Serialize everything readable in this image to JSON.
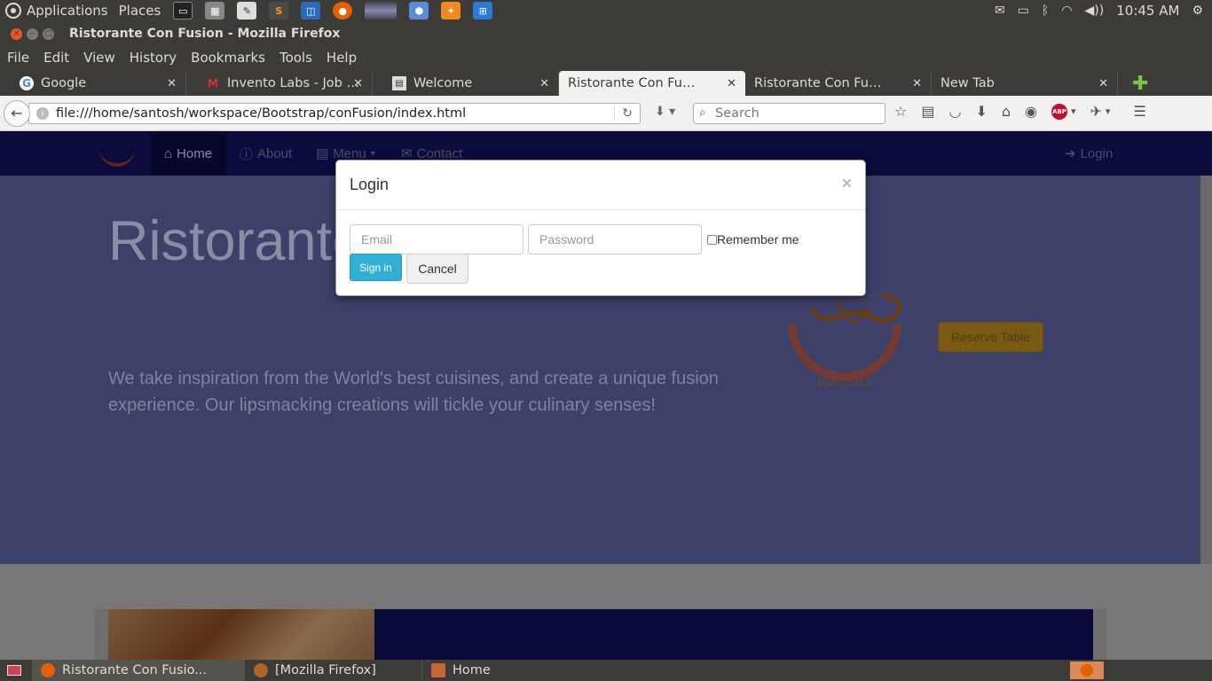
{
  "top_panel": {
    "applications": "Applications",
    "places": "Places",
    "clock": "10:45 AM"
  },
  "window": {
    "title": "Ristorante Con Fusion - Mozilla Firefox"
  },
  "menubar": [
    "File",
    "Edit",
    "View",
    "History",
    "Bookmarks",
    "Tools",
    "Help"
  ],
  "tabs": [
    {
      "label": "Google",
      "icon": "google-icon"
    },
    {
      "label": "Invento Labs - Job O...",
      "icon": "gmail-icon"
    },
    {
      "label": "Welcome",
      "icon": "page-icon"
    },
    {
      "label": "Ristorante Con Fusion",
      "icon": ""
    },
    {
      "label": "Ristorante Con Fusion: ...",
      "icon": ""
    },
    {
      "label": "New Tab",
      "icon": ""
    }
  ],
  "navbar": {
    "url": "file:///home/santosh/workspace/Bootstrap/conFusion/index.html",
    "search_placeholder": "Search"
  },
  "site": {
    "nav": {
      "home": "Home",
      "about": "About",
      "menu": "Menu",
      "contact": "Contact",
      "login": "Login"
    },
    "title": "Ristorante con Fusion",
    "description": "We take inspiration from the World's best cuisines, and create a unique fusion experience. Our lipsmacking creations will tickle your culinary senses!",
    "logo_text": "Ristorante con Fusion",
    "logo_est": "Est. 2013",
    "reserve_button": "Reserve Table"
  },
  "modal": {
    "title": "Login",
    "close": "×",
    "email_placeholder": "Email",
    "password_placeholder": "Password",
    "remember": "Remember me",
    "signin": "Sign in",
    "cancel": "Cancel"
  },
  "taskbar": [
    {
      "label": "Ristorante Con Fusio..."
    },
    {
      "label": "[Mozilla Firefox]"
    },
    {
      "label": "Home"
    }
  ],
  "colors": {
    "panel": "#3c3b37",
    "site_nav": "#0b0c3d",
    "jumbotron": "#3d416a",
    "signin": "#31b0d5",
    "reserve": "#7a5a12"
  }
}
